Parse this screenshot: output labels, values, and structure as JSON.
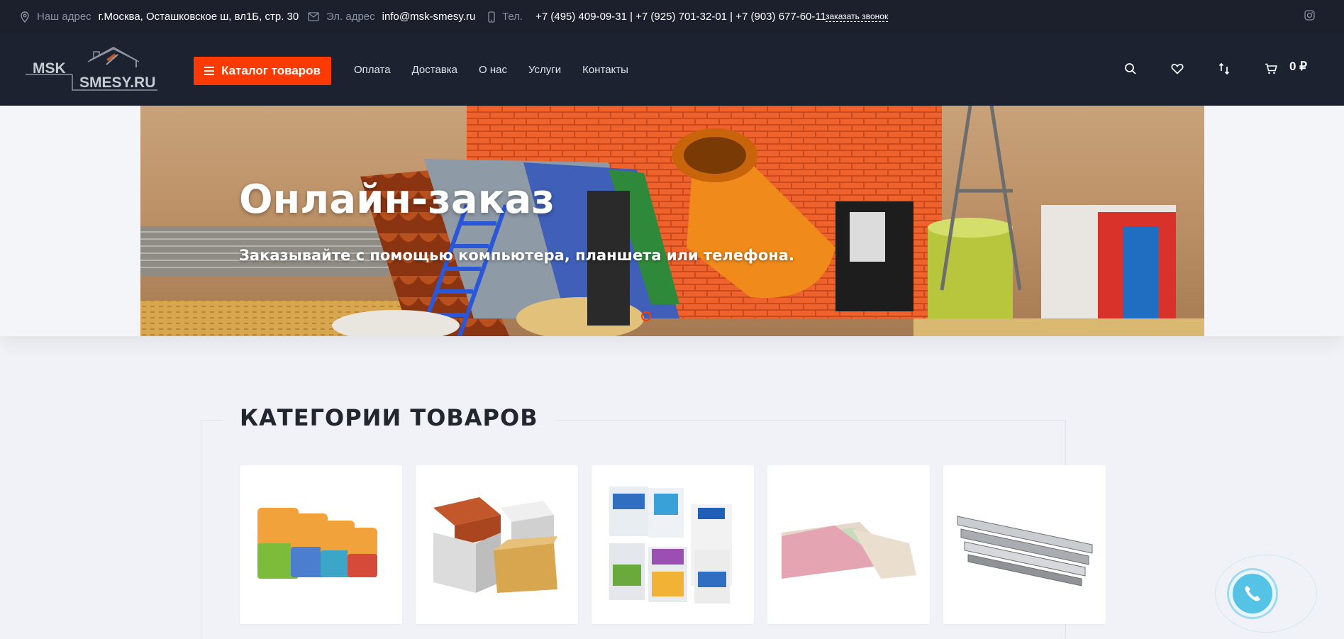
{
  "topbar": {
    "address_label": "Наш адрес",
    "address_value": "г.Москва, Осташковское ш, вл1Б, стр. 30",
    "email_label": "Эл. адрес",
    "email_value": "info@msk-smesy.ru",
    "phone_label": "Тел.",
    "phone_value": "+7 (495) 409-09-31 | +7 (925) 701-32-01 | +7 (903) 677-60-11",
    "callback_label": "заказать звонок"
  },
  "header": {
    "logo_text_top": "MSK",
    "logo_text_bottom": "SMESY.RU",
    "catalog_button": "Каталог товаров",
    "nav": [
      "Оплата",
      "Доставка",
      "О нас",
      "Услуги",
      "Контакты"
    ],
    "cart_total": "0 ₽"
  },
  "hero": {
    "title": "Онлайн-заказ",
    "subtitle": "Заказывайте с помощью компьютера, планшета или телефона."
  },
  "categories": {
    "title": "КАТЕГОРИИ ТОВАРОВ"
  },
  "colors": {
    "accent": "#ff3a00",
    "header_bg": "#1c2230",
    "topbar_bg": "#1b202c",
    "page_bg": "#f1f2f7",
    "call_button": "#54c3e6"
  },
  "icons": [
    "location-pin-icon",
    "mail-icon",
    "phone-icon",
    "instagram-icon",
    "search-icon",
    "heart-icon",
    "compare-icon",
    "cart-icon",
    "handset-icon"
  ]
}
